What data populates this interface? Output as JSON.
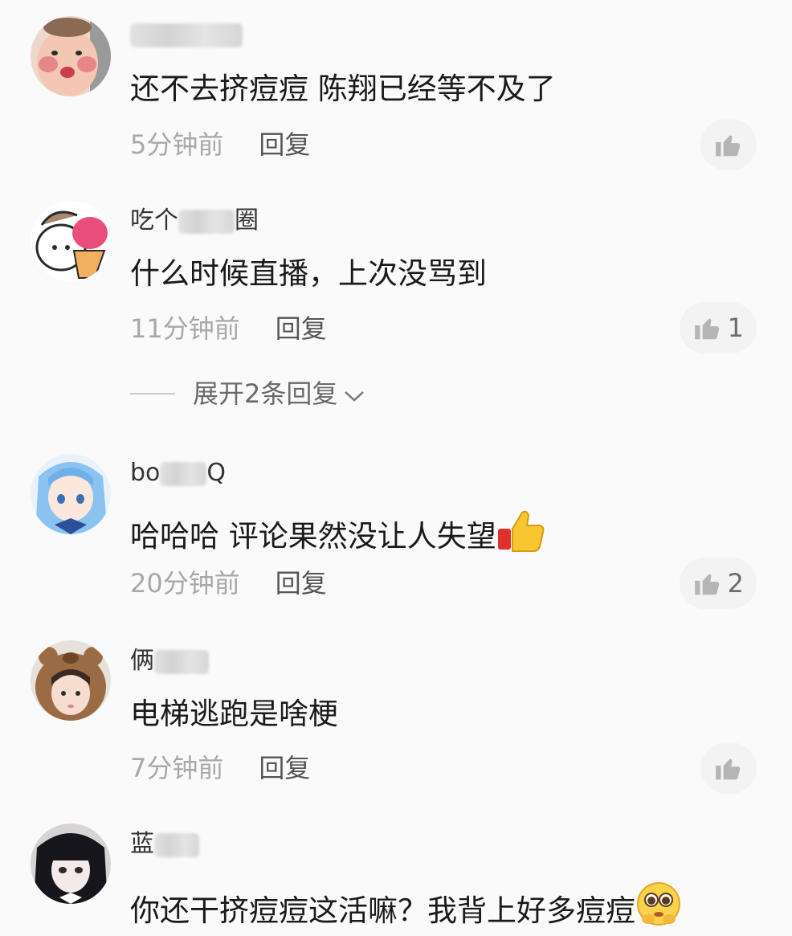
{
  "comments": [
    {
      "username_prefix": "",
      "username_suffix": "",
      "text": "还不去挤痘痘 陈翔已经等不及了",
      "time": "5分钟前",
      "reply_label": "回复",
      "like_count": "",
      "avatar_icon": "baby-face-avatar"
    },
    {
      "username_prefix": "吃个",
      "username_suffix": "圈",
      "text": "什么时候直播，上次没骂到",
      "time": "11分钟前",
      "reply_label": "回复",
      "like_count": "1",
      "avatar_icon": "cartoon-rabbit-avatar"
    },
    {
      "username_prefix": "bo",
      "username_suffix": "Q",
      "text": "哈哈哈 评论果然没让人失望",
      "time": "20分钟前",
      "reply_label": "回复",
      "like_count": "2",
      "avatar_icon": "anime-girl-avatar"
    },
    {
      "username_prefix": "俩",
      "username_suffix": "",
      "text": "电梯逃跑是啥梗",
      "time": "7分钟前",
      "reply_label": "回复",
      "like_count": "",
      "avatar_icon": "bear-hat-girl-avatar"
    },
    {
      "username_prefix": "蓝",
      "username_suffix": "",
      "text": "你还干挤痘痘这活嘛？我背上好多痘痘",
      "time": "",
      "reply_label": "",
      "like_count": "",
      "avatar_icon": "dark-hair-anime-avatar"
    }
  ],
  "expand_replies": "展开2条回复",
  "emojis": [
    "thumbs-up-emoji",
    "pleading-face-emoji"
  ],
  "colors": {
    "background": "#fafafa",
    "text": "#1a1a1a",
    "muted": "#a8a8a8",
    "like_pill": "#f3f3f3"
  }
}
